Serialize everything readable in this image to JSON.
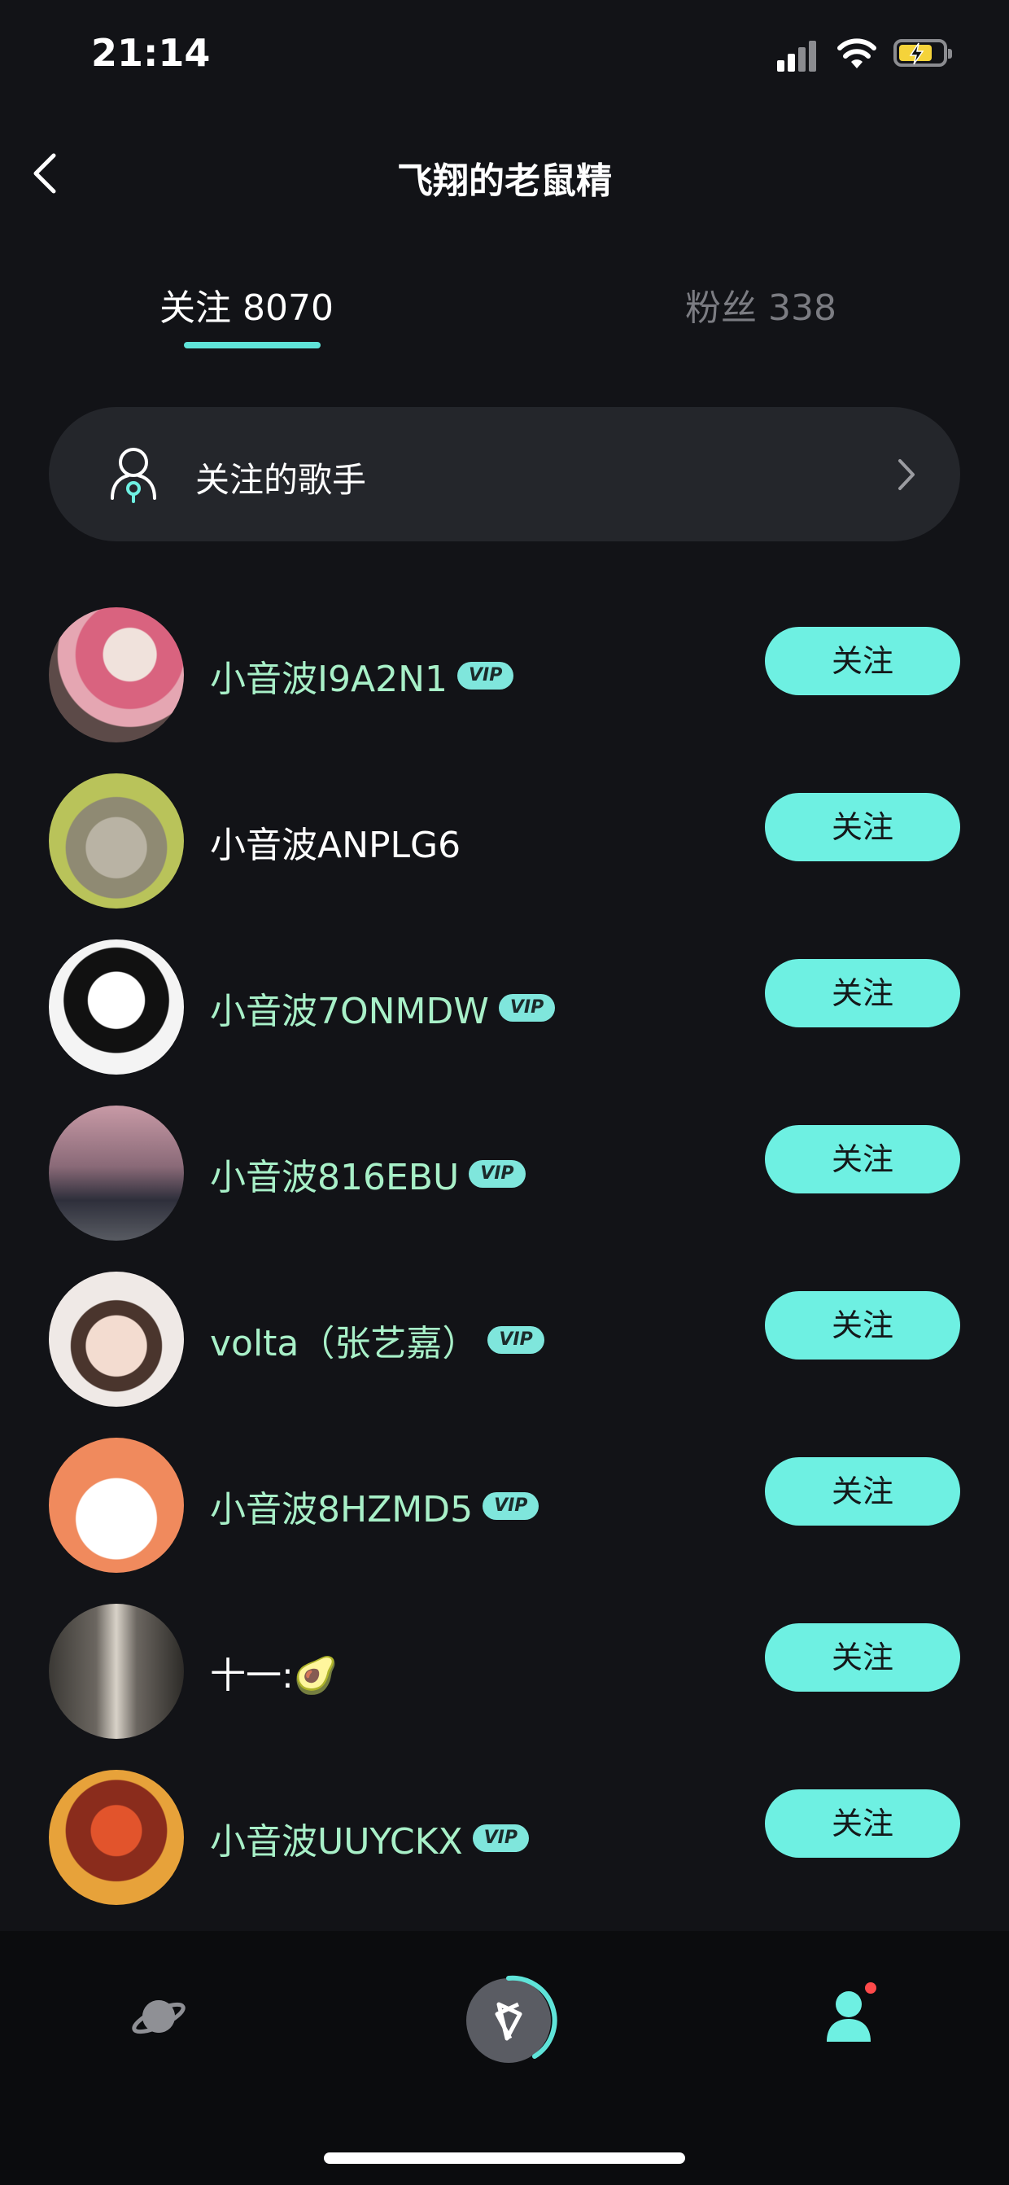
{
  "status_bar": {
    "time": "21:14"
  },
  "header": {
    "title": "飞翔的老鼠精",
    "back_icon": "chevron-left-icon"
  },
  "tabs": [
    {
      "label": "关注 8070",
      "active": true
    },
    {
      "label": "粉丝 338",
      "active": false
    }
  ],
  "singers_entry": {
    "label": "关注的歌手",
    "icon": "singer-icon"
  },
  "follow_list": [
    {
      "name": "小音波I9A2N1",
      "vip": true,
      "vip_label": "VIP",
      "button": "关注"
    },
    {
      "name": "小音波ANPLG6",
      "vip": false,
      "button": "关注"
    },
    {
      "name": "小音波7ONMDW",
      "vip": true,
      "vip_label": "VIP",
      "button": "关注"
    },
    {
      "name": "小音波816EBU",
      "vip": true,
      "vip_label": "VIP",
      "button": "关注"
    },
    {
      "name": "volta（张艺嘉）",
      "vip": true,
      "vip_label": "VIP",
      "button": "关注"
    },
    {
      "name": "小音波8HZMD5",
      "vip": true,
      "vip_label": "VIP",
      "button": "关注"
    },
    {
      "name": "十一:🥑",
      "vip": false,
      "button": "关注"
    },
    {
      "name": "小音波UUYCKX",
      "vip": true,
      "vip_label": "VIP",
      "button": "关注"
    }
  ],
  "colors": {
    "accent": "#6ef0e2",
    "background": "#121317",
    "vip_name": "#a8f0c8"
  }
}
